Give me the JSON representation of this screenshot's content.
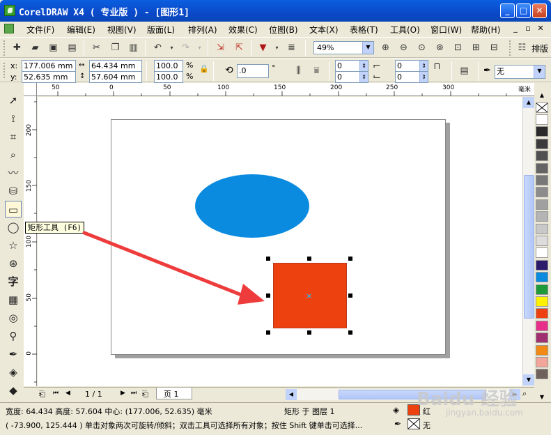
{
  "window": {
    "title": "CorelDRAW X4 ( 专业版 ) - [图形1]",
    "controls": [
      "_",
      "□",
      "✕"
    ]
  },
  "menu": {
    "items": [
      "文件(F)",
      "编辑(E)",
      "视图(V)",
      "版面(L)",
      "排列(A)",
      "效果(C)",
      "位图(B)",
      "文本(X)",
      "表格(T)",
      "工具(O)",
      "窗口(W)",
      "帮助(H)"
    ],
    "doc_controls": [
      "_",
      "▫",
      "✕"
    ]
  },
  "toolbar": {
    "zoom": "49%",
    "layout_label": "排版"
  },
  "property_bar": {
    "x_label": "x:",
    "x": "177.006 mm",
    "y_label": "y:",
    "y": "52.635 mm",
    "width": "64.434 mm",
    "height": "57.604 mm",
    "scale_x": "100.0",
    "scale_y": "100.0",
    "percent": "%",
    "rotation": ".0",
    "degree": "°",
    "corner1": "0",
    "corner2": "0",
    "corner3": "0",
    "corner4": "0",
    "outline": "无"
  },
  "rulers": {
    "top_ticks": [
      "50",
      "0",
      "50",
      "100",
      "150",
      "200",
      "250",
      "300"
    ],
    "unit": "毫米",
    "left_ticks": [
      "200",
      "150",
      "100",
      "50",
      "0"
    ]
  },
  "tooltip": "矩形工具 (F6)",
  "page_nav": {
    "counter": "1 / 1",
    "tab": "页 1"
  },
  "status": {
    "line1": "宽度: 64.434 高度: 57.604 中心: (177.006, 52.635) 毫米",
    "object": "矩形 于 图层 1",
    "fill_name": "红",
    "outline_name": "无",
    "line2": "( -73.900, 125.444 )    单击对象两次可旋转/倾斜；双击工具可选择所有对象；按住 Shift 键单击可选择..."
  },
  "colors": {
    "ellipse_fill": "#0A8BE0",
    "rect_fill": "#EE4110",
    "arrow": "#EE3C3C",
    "titlebar": "#0A49C9"
  },
  "palette": [
    "#FFFFFF",
    "#2A2A2A",
    "#3B3B3B",
    "#505050",
    "#646464",
    "#787878",
    "#8C8C8C",
    "#A0A0A0",
    "#B4B4B4",
    "#C8C8C8",
    "#DCDCDC",
    "#FFFFFF",
    "#2C1A6B",
    "#0A8BE0",
    "#1E9A3A",
    "#FFF200",
    "#EE4110",
    "#E8308A",
    "#A0306F",
    "#F08A14",
    "#F2A69A",
    "#6E625A"
  ],
  "watermark": {
    "brand": "Baidu 经验",
    "url": "jingyan.baidu.com"
  }
}
